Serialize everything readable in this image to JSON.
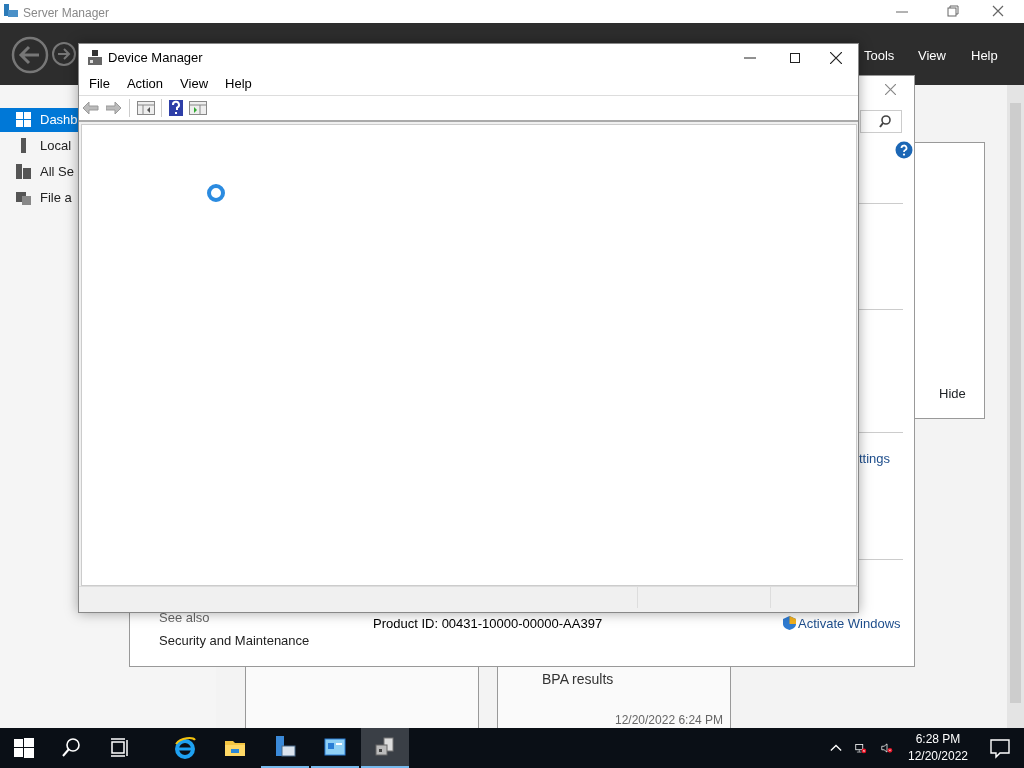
{
  "server_manager": {
    "title": "Server Manager",
    "menu": [
      "Tools",
      "View",
      "Help"
    ],
    "sidebar": [
      {
        "label": "Dashb",
        "selected": true
      },
      {
        "label": "Local",
        "selected": false
      },
      {
        "label": "All Se",
        "selected": false
      },
      {
        "label": "File a",
        "selected": false
      }
    ],
    "hide_button": "Hide",
    "tile_title": "BPA results",
    "tile_time": "12/20/2022 6:24 PM"
  },
  "system_window": {
    "settings_link": "ttings",
    "see_also": "See also",
    "security_link": "Security and Maintenance",
    "product_id": "Product ID: 00431-10000-00000-AA397",
    "activate_link": "Activate Windows"
  },
  "device_manager": {
    "title": "Device Manager",
    "menu": [
      "File",
      "Action",
      "View",
      "Help"
    ],
    "loading": true
  },
  "taskbar": {
    "apps": [
      {
        "kind": "browser",
        "running": false,
        "selected": false
      },
      {
        "kind": "folder",
        "running": false,
        "selected": false
      },
      {
        "kind": "server",
        "running": true,
        "selected": false
      },
      {
        "kind": "panel",
        "running": true,
        "selected": false
      },
      {
        "kind": "device",
        "running": true,
        "selected": true
      }
    ],
    "time": "6:28 PM",
    "date": "12/20/2022"
  }
}
